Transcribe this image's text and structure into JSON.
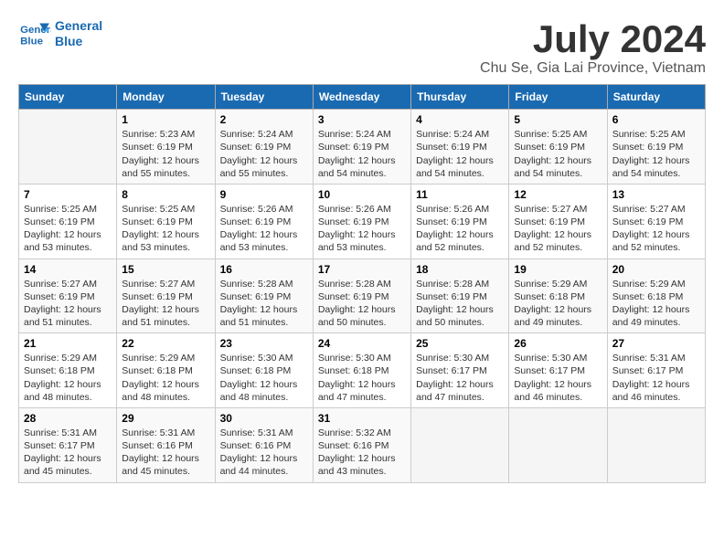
{
  "header": {
    "logo_line1": "General",
    "logo_line2": "Blue",
    "month_title": "July 2024",
    "location": "Chu Se, Gia Lai Province, Vietnam"
  },
  "weekdays": [
    "Sunday",
    "Monday",
    "Tuesday",
    "Wednesday",
    "Thursday",
    "Friday",
    "Saturday"
  ],
  "weeks": [
    [
      {
        "day": "",
        "info": ""
      },
      {
        "day": "1",
        "info": "Sunrise: 5:23 AM\nSunset: 6:19 PM\nDaylight: 12 hours\nand 55 minutes."
      },
      {
        "day": "2",
        "info": "Sunrise: 5:24 AM\nSunset: 6:19 PM\nDaylight: 12 hours\nand 55 minutes."
      },
      {
        "day": "3",
        "info": "Sunrise: 5:24 AM\nSunset: 6:19 PM\nDaylight: 12 hours\nand 54 minutes."
      },
      {
        "day": "4",
        "info": "Sunrise: 5:24 AM\nSunset: 6:19 PM\nDaylight: 12 hours\nand 54 minutes."
      },
      {
        "day": "5",
        "info": "Sunrise: 5:25 AM\nSunset: 6:19 PM\nDaylight: 12 hours\nand 54 minutes."
      },
      {
        "day": "6",
        "info": "Sunrise: 5:25 AM\nSunset: 6:19 PM\nDaylight: 12 hours\nand 54 minutes."
      }
    ],
    [
      {
        "day": "7",
        "info": "Sunrise: 5:25 AM\nSunset: 6:19 PM\nDaylight: 12 hours\nand 53 minutes."
      },
      {
        "day": "8",
        "info": "Sunrise: 5:25 AM\nSunset: 6:19 PM\nDaylight: 12 hours\nand 53 minutes."
      },
      {
        "day": "9",
        "info": "Sunrise: 5:26 AM\nSunset: 6:19 PM\nDaylight: 12 hours\nand 53 minutes."
      },
      {
        "day": "10",
        "info": "Sunrise: 5:26 AM\nSunset: 6:19 PM\nDaylight: 12 hours\nand 53 minutes."
      },
      {
        "day": "11",
        "info": "Sunrise: 5:26 AM\nSunset: 6:19 PM\nDaylight: 12 hours\nand 52 minutes."
      },
      {
        "day": "12",
        "info": "Sunrise: 5:27 AM\nSunset: 6:19 PM\nDaylight: 12 hours\nand 52 minutes."
      },
      {
        "day": "13",
        "info": "Sunrise: 5:27 AM\nSunset: 6:19 PM\nDaylight: 12 hours\nand 52 minutes."
      }
    ],
    [
      {
        "day": "14",
        "info": "Sunrise: 5:27 AM\nSunset: 6:19 PM\nDaylight: 12 hours\nand 51 minutes."
      },
      {
        "day": "15",
        "info": "Sunrise: 5:27 AM\nSunset: 6:19 PM\nDaylight: 12 hours\nand 51 minutes."
      },
      {
        "day": "16",
        "info": "Sunrise: 5:28 AM\nSunset: 6:19 PM\nDaylight: 12 hours\nand 51 minutes."
      },
      {
        "day": "17",
        "info": "Sunrise: 5:28 AM\nSunset: 6:19 PM\nDaylight: 12 hours\nand 50 minutes."
      },
      {
        "day": "18",
        "info": "Sunrise: 5:28 AM\nSunset: 6:19 PM\nDaylight: 12 hours\nand 50 minutes."
      },
      {
        "day": "19",
        "info": "Sunrise: 5:29 AM\nSunset: 6:18 PM\nDaylight: 12 hours\nand 49 minutes."
      },
      {
        "day": "20",
        "info": "Sunrise: 5:29 AM\nSunset: 6:18 PM\nDaylight: 12 hours\nand 49 minutes."
      }
    ],
    [
      {
        "day": "21",
        "info": "Sunrise: 5:29 AM\nSunset: 6:18 PM\nDaylight: 12 hours\nand 48 minutes."
      },
      {
        "day": "22",
        "info": "Sunrise: 5:29 AM\nSunset: 6:18 PM\nDaylight: 12 hours\nand 48 minutes."
      },
      {
        "day": "23",
        "info": "Sunrise: 5:30 AM\nSunset: 6:18 PM\nDaylight: 12 hours\nand 48 minutes."
      },
      {
        "day": "24",
        "info": "Sunrise: 5:30 AM\nSunset: 6:18 PM\nDaylight: 12 hours\nand 47 minutes."
      },
      {
        "day": "25",
        "info": "Sunrise: 5:30 AM\nSunset: 6:17 PM\nDaylight: 12 hours\nand 47 minutes."
      },
      {
        "day": "26",
        "info": "Sunrise: 5:30 AM\nSunset: 6:17 PM\nDaylight: 12 hours\nand 46 minutes."
      },
      {
        "day": "27",
        "info": "Sunrise: 5:31 AM\nSunset: 6:17 PM\nDaylight: 12 hours\nand 46 minutes."
      }
    ],
    [
      {
        "day": "28",
        "info": "Sunrise: 5:31 AM\nSunset: 6:17 PM\nDaylight: 12 hours\nand 45 minutes."
      },
      {
        "day": "29",
        "info": "Sunrise: 5:31 AM\nSunset: 6:16 PM\nDaylight: 12 hours\nand 45 minutes."
      },
      {
        "day": "30",
        "info": "Sunrise: 5:31 AM\nSunset: 6:16 PM\nDaylight: 12 hours\nand 44 minutes."
      },
      {
        "day": "31",
        "info": "Sunrise: 5:32 AM\nSunset: 6:16 PM\nDaylight: 12 hours\nand 43 minutes."
      },
      {
        "day": "",
        "info": ""
      },
      {
        "day": "",
        "info": ""
      },
      {
        "day": "",
        "info": ""
      }
    ]
  ]
}
